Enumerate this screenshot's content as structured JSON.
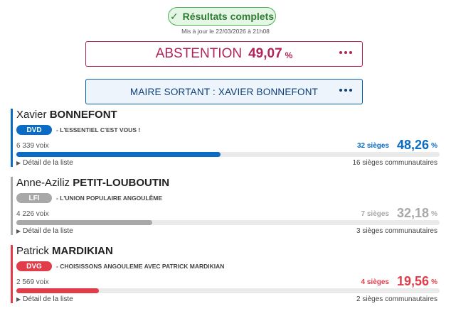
{
  "header": {
    "status": "Résultats complets",
    "updated": "Mis à jour le 22/03/2026 à 21h08"
  },
  "abstention": {
    "label": "ABSTENTION",
    "value": "49,07",
    "unit": "%"
  },
  "maire": {
    "label": "MAIRE SORTANT : XAVIER BONNEFONT"
  },
  "colors": {
    "dvd": "#0b6cc1",
    "lfi": "#a8a8a8",
    "dvg": "#e03c4a",
    "status_green": "#2e7d32",
    "abstention": "#b0245a"
  },
  "candidates": [
    {
      "first": "Xavier",
      "last": "BONNEFONT",
      "party": "DVD",
      "slogan": "- L'ESSENTIEL C'EST VOUS !",
      "votes": "6 339 voix",
      "seats": "32 sièges",
      "percent": "48,26",
      "percent_unit": "%",
      "share": 0.4826,
      "detail": "Détail de la liste",
      "council": "16 sièges communautaires",
      "color": "#0b6cc1"
    },
    {
      "first": "Anne-Aziliz",
      "last": "PETIT-LOUBOUTIN",
      "party": "LFI",
      "slogan": "- L'UNION POPULAIRE ANGOULÊME",
      "votes": "4 226 voix",
      "seats": "7 sièges",
      "percent": "32,18",
      "percent_unit": "%",
      "share": 0.3218,
      "detail": "Détail de la liste",
      "council": "3 sièges communautaires",
      "color": "#a8a8a8"
    },
    {
      "first": "Patrick",
      "last": "MARDIKIAN",
      "party": "DVG",
      "slogan": "- CHOISISSONS ANGOULEME AVEC PATRICK MARDIKIAN",
      "votes": "2 569 voix",
      "seats": "4 sièges",
      "percent": "19,56",
      "percent_unit": "%",
      "share": 0.1956,
      "detail": "Détail de la liste",
      "council": "2 sièges communautaires",
      "color": "#e03c4a"
    }
  ]
}
